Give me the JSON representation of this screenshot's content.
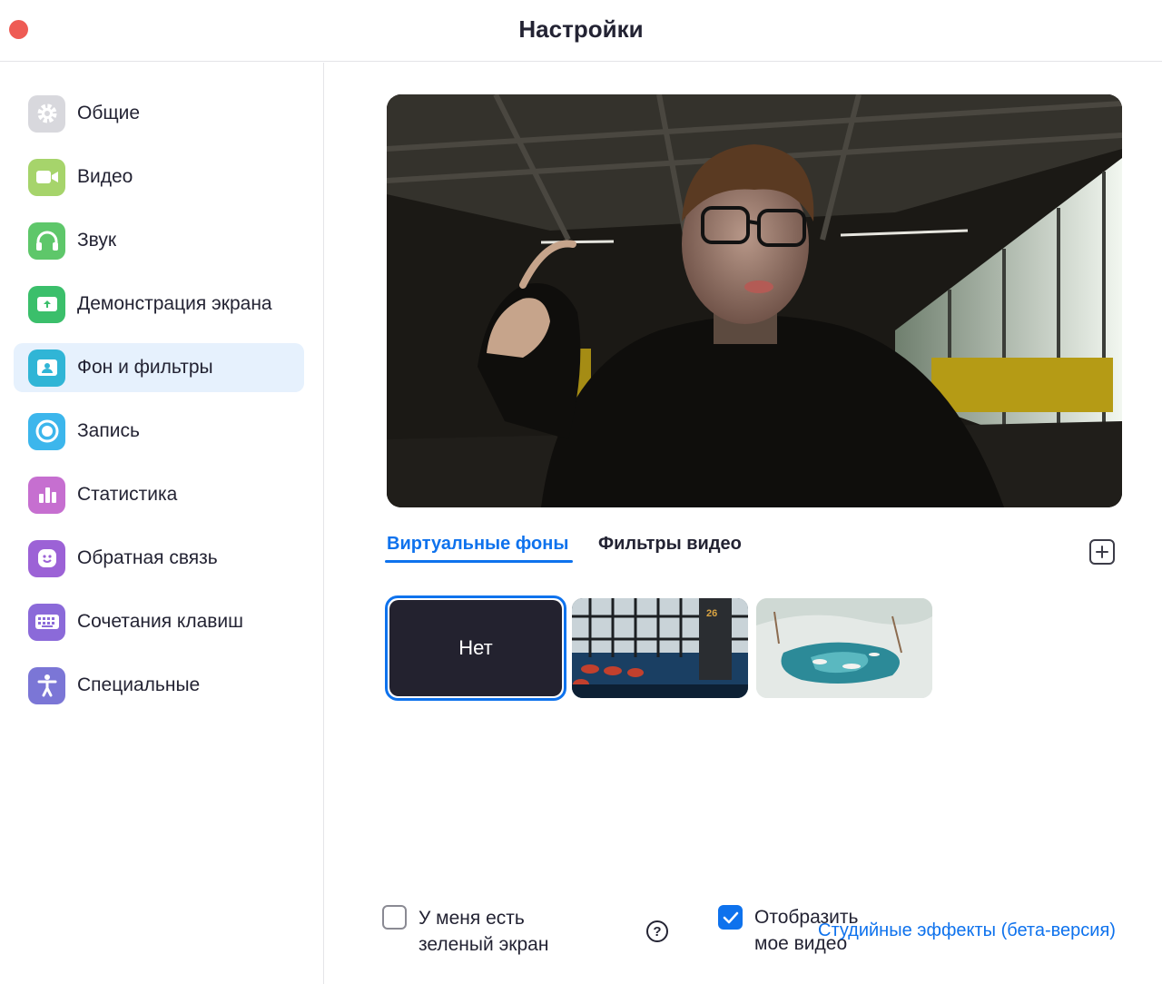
{
  "window": {
    "title": "Настройки"
  },
  "sidebar": {
    "items": [
      {
        "label": "Общие",
        "icon": "gear-icon",
        "color": "#d8d8dd",
        "active": false
      },
      {
        "label": "Видео",
        "icon": "video-camera-icon",
        "color": "#a6d46b",
        "active": false
      },
      {
        "label": "Звук",
        "icon": "headphones-icon",
        "color": "#5ec76a",
        "active": false
      },
      {
        "label": "Демонстрация экрана",
        "icon": "share-screen-icon",
        "color": "#3bbf6b",
        "active": false
      },
      {
        "label": "Фон и фильтры",
        "icon": "background-portrait-icon",
        "color": "#30b5d6",
        "active": true
      },
      {
        "label": "Запись",
        "icon": "record-icon",
        "color": "#3cb6ec",
        "active": false
      },
      {
        "label": "Статистика",
        "icon": "bar-chart-icon",
        "color": "#c66fd0",
        "active": false
      },
      {
        "label": "Обратная связь",
        "icon": "smiley-icon",
        "color": "#9c62d6",
        "active": false
      },
      {
        "label": "Сочетания клавиш",
        "icon": "keyboard-icon",
        "color": "#8b6ad9",
        "active": false
      },
      {
        "label": "Специальные",
        "icon": "accessibility-icon",
        "color": "#7b76d6",
        "active": false
      }
    ]
  },
  "tabs": {
    "virtual_label": "Виртуальные фоны",
    "filters_label": "Фильтры видео",
    "active": "virtual"
  },
  "backgrounds": {
    "none_label": "Нет",
    "items": [
      {
        "name": "none",
        "selected": true
      },
      {
        "name": "airport",
        "selected": false
      },
      {
        "name": "winter-painting",
        "selected": false
      }
    ]
  },
  "options": {
    "green_screen_label_line1": "У меня есть",
    "green_screen_label_line2": "зеленый экран",
    "green_screen_checked": false,
    "mirror_label_line1": "Отобразить",
    "mirror_label_line2": "мое видео",
    "mirror_checked": true,
    "help_glyph": "?",
    "studio_effects_link": "Студийные эффекты (бета-версия)"
  },
  "colors": {
    "accent": "#0e72ed",
    "active_nav_bg": "#e6f1fd",
    "close_button": "#ee5b54"
  }
}
